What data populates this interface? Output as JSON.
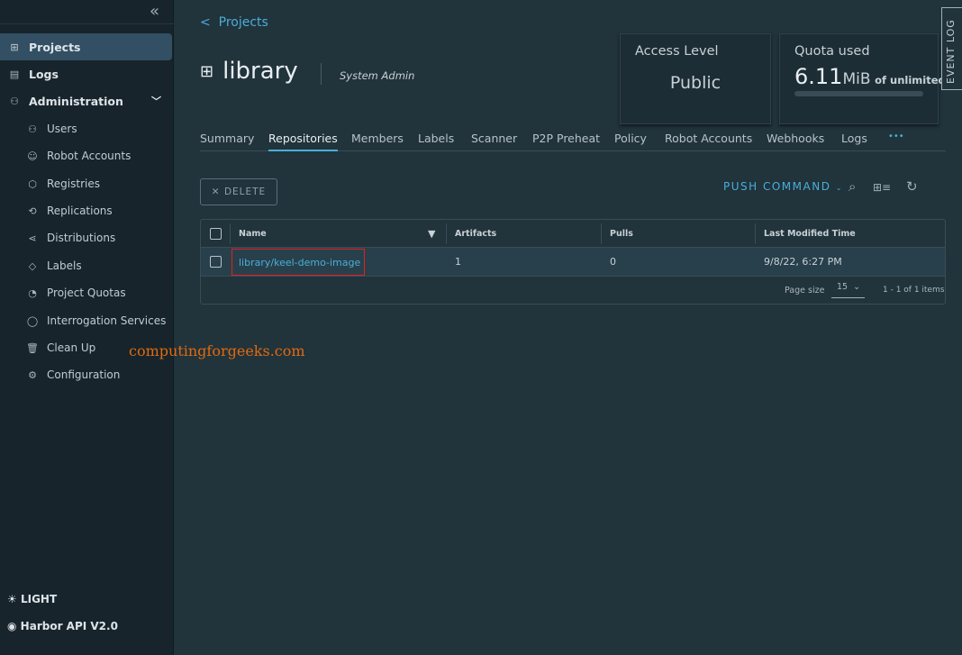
{
  "sidebar": {
    "top": [
      {
        "label": "Projects",
        "icon": "projects-icon"
      },
      {
        "label": "Logs",
        "icon": "logs-icon"
      },
      {
        "label": "Administration",
        "icon": "admin-icon"
      }
    ],
    "admin_items": [
      {
        "label": "Users",
        "icon": "users-icon"
      },
      {
        "label": "Robot Accounts",
        "icon": "robot-icon"
      },
      {
        "label": "Registries",
        "icon": "registry-icon"
      },
      {
        "label": "Replications",
        "icon": "replication-icon"
      },
      {
        "label": "Distributions",
        "icon": "distribution-icon"
      },
      {
        "label": "Labels",
        "icon": "label-icon"
      },
      {
        "label": "Project Quotas",
        "icon": "quota-icon"
      },
      {
        "label": "Interrogation Services",
        "icon": "shield-icon"
      },
      {
        "label": "Clean Up",
        "icon": "trash-icon"
      },
      {
        "label": "Configuration",
        "icon": "gear-icon"
      }
    ],
    "theme": "LIGHT",
    "api": "Harbor API V2.0"
  },
  "breadcrumb": "Projects",
  "project": {
    "name": "library",
    "role": "System Admin"
  },
  "access": {
    "label": "Access Level",
    "value": "Public"
  },
  "quota": {
    "label": "Quota used",
    "value": "6.11",
    "unit": "MiB",
    "suffix": "of unlimited"
  },
  "event_log": "EVENT LOG",
  "tabs": [
    "Summary",
    "Repositories",
    "Members",
    "Labels",
    "Scanner",
    "P2P Preheat",
    "Policy",
    "Robot Accounts",
    "Webhooks",
    "Logs",
    "•••"
  ],
  "active_tab": "Repositories",
  "toolbar": {
    "delete": "DELETE",
    "push": "PUSH COMMAND"
  },
  "table": {
    "headers": [
      "Name",
      "Artifacts",
      "Pulls",
      "Last Modified Time"
    ],
    "rows": [
      {
        "name": "library/keel-demo-image",
        "artifacts": "1",
        "pulls": "0",
        "modified": "9/8/22, 6:27 PM"
      }
    ],
    "page_size_label": "Page size",
    "page_size": "15",
    "count": "1 - 1 of 1 items"
  },
  "watermark": "computingforgeeks.com",
  "colors": {
    "accent": "#4aaed9",
    "highlight_box": "#e02020"
  }
}
